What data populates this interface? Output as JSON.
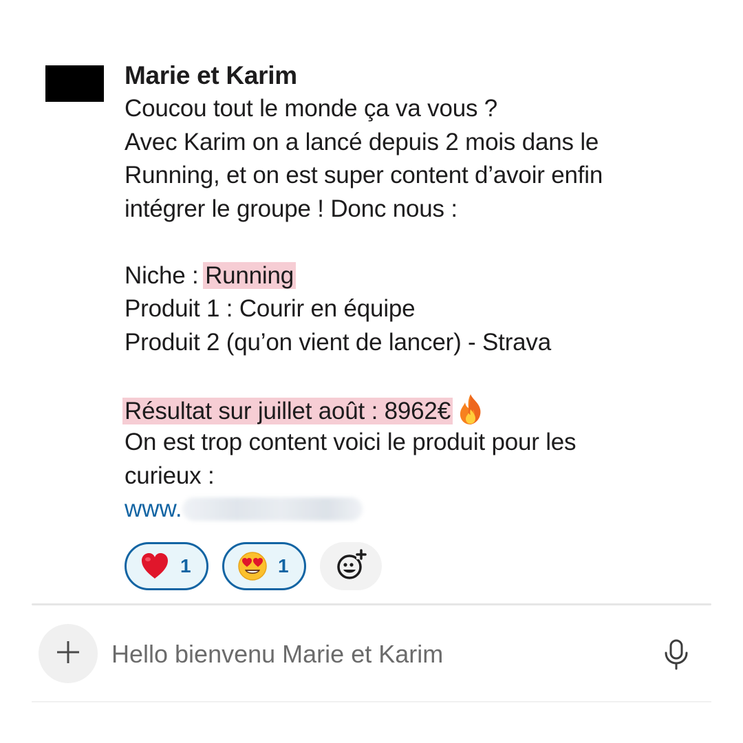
{
  "message": {
    "sender": "Marie et Karim",
    "lines": [
      "Coucou tout le monde ça va vous ?",
      "Avec Karim on a lancé depuis 2 mois dans le",
      "Running, et on est super content d’avoir enfin",
      "intégrer le groupe ! Donc nous :"
    ],
    "niche_label": "Niche : ",
    "niche_value": "Running",
    "product1": "Produit 1 : Courir en équipe",
    "product2": "Produit 2 (qu’on vient de lancer) - Strava",
    "result": "Résultat sur juillet août : 8962€",
    "result_emoji": "fire-emoji",
    "closing_1": "On est trop content voici le produit pour les",
    "closing_2": "curieux :",
    "link_prefix": "www."
  },
  "reactions": [
    {
      "emoji": "red-heart-emoji",
      "count": "1"
    },
    {
      "emoji": "heart-eyes-emoji",
      "count": "1"
    }
  ],
  "composer": {
    "placeholder": "Hello bienvenu Marie et Karim"
  },
  "colors": {
    "highlight": "#f6cdd4",
    "link": "#1264a3",
    "reaction_border": "#1264a3",
    "reaction_bg": "#e8f5fa"
  }
}
